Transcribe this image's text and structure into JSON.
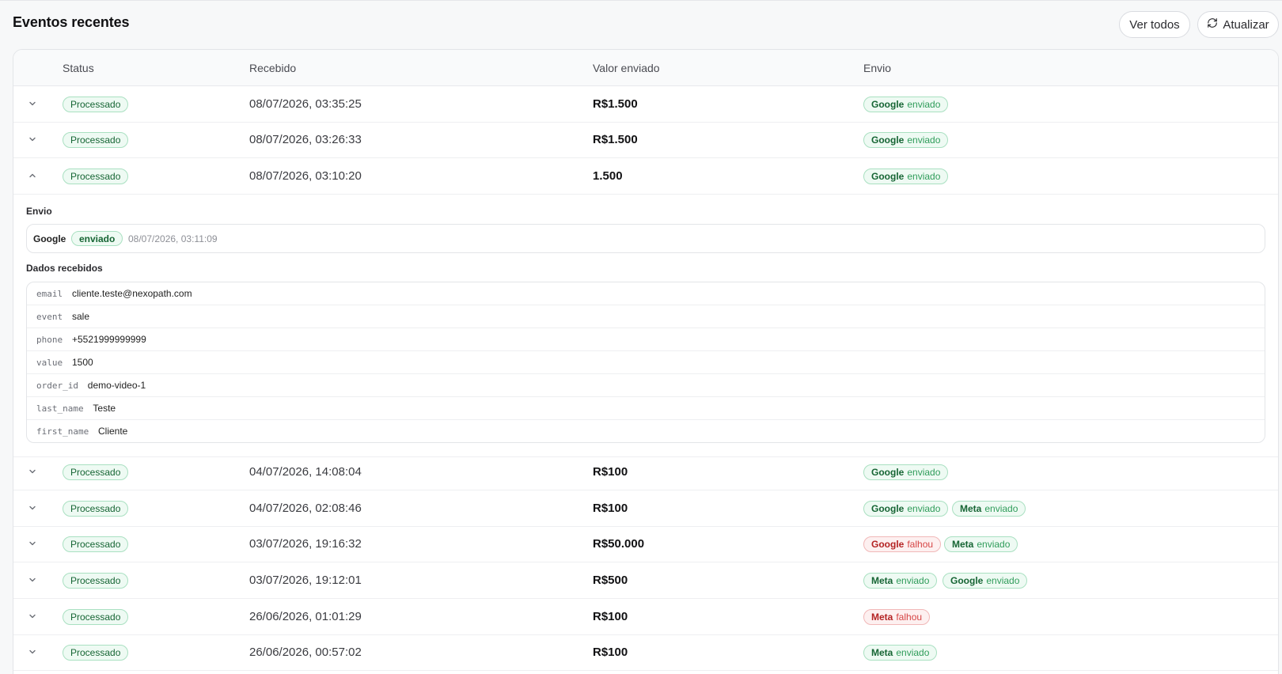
{
  "header": {
    "title": "Eventos recentes",
    "view_all": "Ver todos",
    "refresh": "Atualizar"
  },
  "table": {
    "columns": [
      "Status",
      "Recebido",
      "Valor enviado",
      "Envio"
    ],
    "rows": [
      {
        "status": "Processado",
        "received": "08/07/2026, 03:35:25",
        "value": "R$1.500",
        "expanded": false,
        "sends": [
          {
            "provider": "Google",
            "result": "enviado",
            "ok": true
          }
        ]
      },
      {
        "status": "Processado",
        "received": "08/07/2026, 03:26:33",
        "value": "R$1.500",
        "expanded": false,
        "sends": [
          {
            "provider": "Google",
            "result": "enviado",
            "ok": true
          }
        ]
      },
      {
        "status": "Processado",
        "received": "08/07/2026, 03:10:20",
        "value": "1.500",
        "expanded": true,
        "sends": [
          {
            "provider": "Google",
            "result": "enviado",
            "ok": true
          }
        ]
      },
      {
        "status": "Processado",
        "received": "04/07/2026, 14:08:04",
        "value": "R$100",
        "expanded": false,
        "sends": [
          {
            "provider": "Google",
            "result": "enviado",
            "ok": true
          }
        ]
      },
      {
        "status": "Processado",
        "received": "04/07/2026, 02:08:46",
        "value": "R$100",
        "expanded": false,
        "sends": [
          {
            "provider": "Google",
            "result": "enviado",
            "ok": true
          },
          {
            "provider": "Meta",
            "result": "enviado",
            "ok": true
          }
        ]
      },
      {
        "status": "Processado",
        "received": "03/07/2026, 19:16:32",
        "value": "R$50.000",
        "expanded": false,
        "sends": [
          {
            "provider": "Google",
            "result": "falhou",
            "ok": false
          },
          {
            "provider": "Meta",
            "result": "enviado",
            "ok": true
          }
        ]
      },
      {
        "status": "Processado",
        "received": "03/07/2026, 19:12:01",
        "value": "R$500",
        "expanded": false,
        "sends": [
          {
            "provider": "Meta",
            "result": "enviado",
            "ok": true
          },
          {
            "provider": "Google",
            "result": "enviado",
            "ok": true
          }
        ]
      },
      {
        "status": "Processado",
        "received": "26/06/2026, 01:01:29",
        "value": "R$100",
        "expanded": false,
        "sends": [
          {
            "provider": "Meta",
            "result": "falhou",
            "ok": false
          }
        ]
      },
      {
        "status": "Processado",
        "received": "26/06/2026, 00:57:02",
        "value": "R$100",
        "expanded": false,
        "sends": [
          {
            "provider": "Meta",
            "result": "enviado",
            "ok": true
          }
        ]
      }
    ]
  },
  "detail": {
    "envio_label": "Envio",
    "envio": {
      "provider": "Google",
      "status": "enviado",
      "timestamp": "08/07/2026, 03:11:09"
    },
    "data_label": "Dados recebidos",
    "fields": [
      {
        "key": "email",
        "value": "cliente.teste@nexopath.com"
      },
      {
        "key": "event",
        "value": "sale"
      },
      {
        "key": "phone",
        "value": "+5521999999999"
      },
      {
        "key": "value",
        "value": "1500"
      },
      {
        "key": "order_id",
        "value": "demo-video-1"
      },
      {
        "key": "last_name",
        "value": "Teste"
      },
      {
        "key": "first_name",
        "value": "Cliente"
      }
    ]
  },
  "colors": {
    "success_bg": "#eefaf3",
    "success_text": "#166534",
    "fail_bg": "#fdf0f0",
    "fail_text": "#b42323"
  }
}
